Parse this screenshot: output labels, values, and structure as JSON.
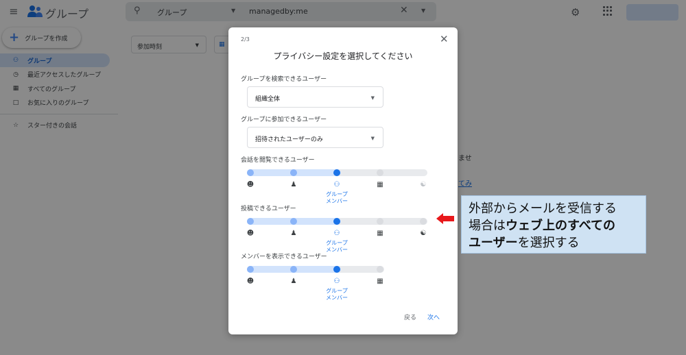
{
  "app": {
    "title": "グループ"
  },
  "search": {
    "scope": "グループ",
    "query": "managedby:me"
  },
  "sidebar": {
    "create_label": "グループを作成",
    "items": [
      {
        "label": "グループ",
        "icon": "groups-icon",
        "active": true
      },
      {
        "label": "最近アクセスしたグループ",
        "icon": "clock-icon"
      },
      {
        "label": "すべてのグループ",
        "icon": "building-icon"
      },
      {
        "label": "お気に入りのグループ",
        "icon": "folder-icon"
      }
    ],
    "starred_label": "スター付きの会話"
  },
  "main": {
    "filter_label": "参加時刻",
    "background_text": "ませ",
    "background_link": "てみ"
  },
  "dialog": {
    "step": "2/3",
    "title": "プライバシー設定を選択してください",
    "who_can_search": {
      "label": "グループを検索できるユーザー",
      "value": "組織全体"
    },
    "who_can_join": {
      "label": "グループに参加できるユーザー",
      "value": "招待されたユーザーのみ"
    },
    "who_can_view": {
      "label": "会話を閲覧できるユーザー",
      "selected_label": "グループ\nメンバー"
    },
    "who_can_post": {
      "label": "投稿できるユーザー",
      "selected_label": "グループ\nメンバー"
    },
    "who_can_view_members": {
      "label": "メンバーを表示できるユーザー",
      "selected_label": "グループ\nメンバー"
    },
    "back_label": "戻る",
    "next_label": "次へ"
  },
  "annotation": {
    "line1": "外部からメールを受信する",
    "line2_prefix": "場合は",
    "line2_bold": "ウェブ上のすべての",
    "line3_bold": "ユーザー",
    "line3_suffix": "を選択する",
    "arrow_color": "#e8181b"
  }
}
